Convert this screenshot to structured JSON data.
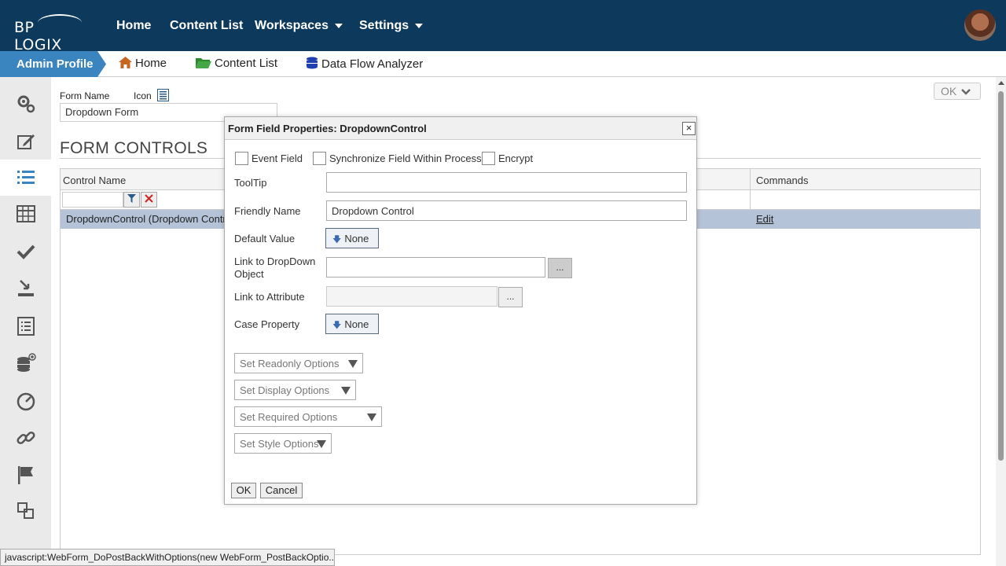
{
  "app": {
    "logo_text": "BP LOGIX"
  },
  "topnav": {
    "items": [
      "Home",
      "Content List",
      "Workspaces",
      "Settings"
    ]
  },
  "breadcrumb": {
    "active": "Admin Profile",
    "items": [
      "Home",
      "Content List",
      "Data Flow Analyzer"
    ]
  },
  "sidebar": {
    "icons": [
      "gears-icon",
      "edit-icon",
      "list-icon",
      "table-icon",
      "check-icon",
      "import-icon",
      "document-list-icon",
      "database-add-icon",
      "dashboard-icon",
      "link-icon",
      "flag-icon",
      "copy-icon",
      "file-icon"
    ],
    "active_index": 2
  },
  "form": {
    "name_label": "Form Name",
    "icon_label": "Icon",
    "name_value": "Dropdown Form",
    "section_title": "FORM CONTROLS",
    "ok_label": "OK",
    "grid": {
      "columns": [
        "Control Name",
        "Commands"
      ],
      "rows": [
        {
          "control_name": "DropdownControl (Dropdown Control)",
          "command": "Edit"
        }
      ]
    }
  },
  "dialog": {
    "title": "Form Field Properties: DropdownControl",
    "close": "×",
    "checkboxes": [
      "Event Field",
      "Synchronize Field Within Process",
      "Encrypt"
    ],
    "fields": {
      "tooltip_label": "ToolTip",
      "tooltip_value": "",
      "friendly_name_label": "Friendly Name",
      "friendly_name_value": "Dropdown Control",
      "default_value_label": "Default Value",
      "default_value_btn": "None",
      "link_dropdown_label": "Link to DropDown Object",
      "link_attribute_label": "Link to Attribute",
      "case_property_label": "Case Property",
      "case_property_btn": "None",
      "ellipsis": "..."
    },
    "options": [
      "Set Readonly Options",
      "Set Display Options",
      "Set Required Options",
      "Set Style Options"
    ],
    "ok": "OK",
    "cancel": "Cancel"
  },
  "statusbar": {
    "text": "javascript:WebForm_DoPostBackWithOptions(new WebForm_PostBackOptio..."
  },
  "colors": {
    "topnav": "#0d3a5c",
    "active_crumb": "#3a85c0",
    "selected_row": "#b5c3d8"
  }
}
